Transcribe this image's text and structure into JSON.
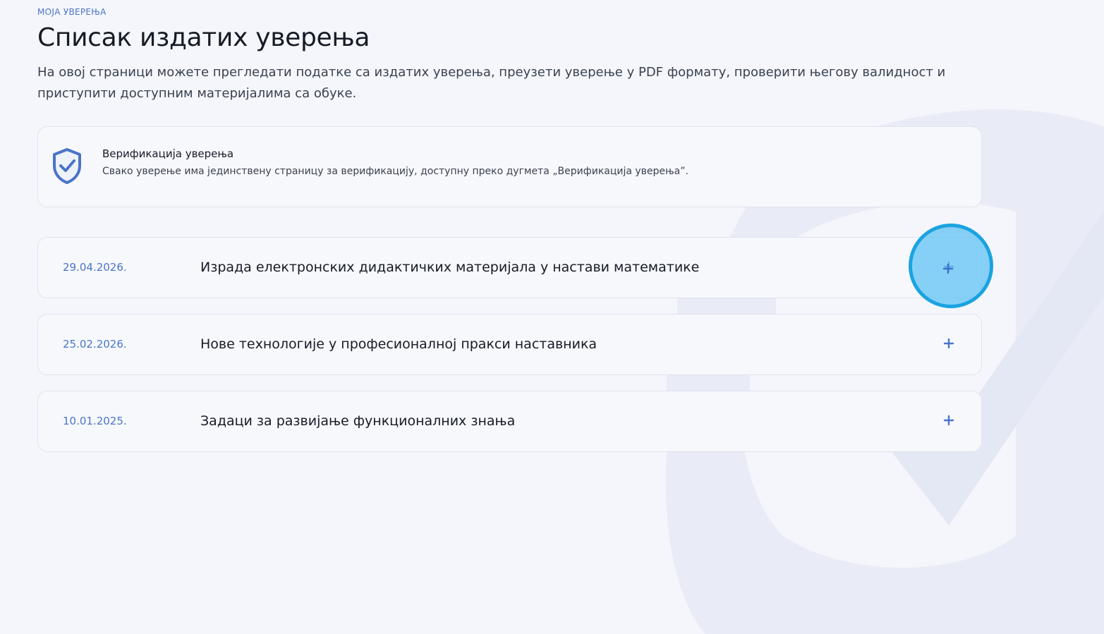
{
  "header": {
    "eyebrow": "МОЈА УВЕРЕЊА",
    "title": "Списак издатих уверења",
    "intro": "На овој страници можете прегледати податке са издатих уверења, преузети уверење у PDF формату, проверити његову валидност и приступити доступним материјалима са обуке."
  },
  "verification": {
    "icon": "shield-check-icon",
    "title": "Верификација уверења",
    "text": "Свако уверење има јединствену страницу за верификацију, доступну преко дугмета „Верификација уверења”."
  },
  "certificates": [
    {
      "date": "29.04.2026.",
      "title": "Израда електронских дидактичких материјала у настави математике",
      "icon": "plus-icon"
    },
    {
      "date": "25.02.2026.",
      "title": "Нове технологије у професионалној пракси наставника",
      "icon": "plus-icon"
    },
    {
      "date": "10.01.2025.",
      "title": "Задаци за развијање функционалних знања",
      "icon": "plus-icon"
    }
  ],
  "colors": {
    "accent": "#4a74c8",
    "background": "#f4f6fb",
    "click_indicator": "#1ba3e0"
  }
}
